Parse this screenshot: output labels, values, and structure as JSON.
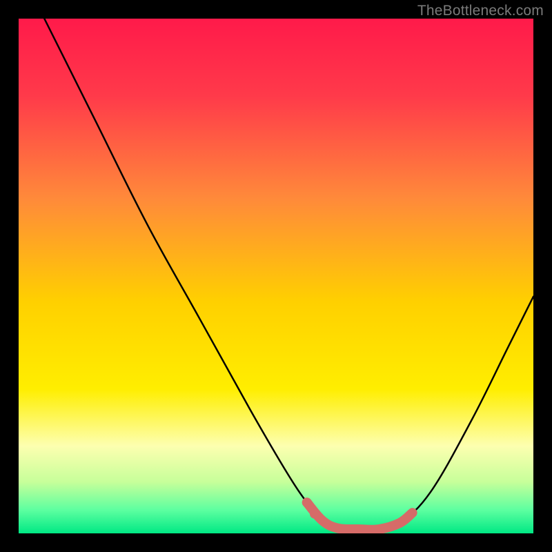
{
  "watermark": "TheBottleneck.com",
  "colors": {
    "curve": "#000000",
    "highlight": "#d66b68",
    "frame": "#000000"
  },
  "chart_data": {
    "type": "line",
    "title": "",
    "xlabel": "",
    "ylabel": "",
    "xlim": [
      0,
      100
    ],
    "ylim": [
      0,
      100
    ],
    "grid": false,
    "legend": false,
    "gradient_stops": [
      {
        "pos": 0.0,
        "color": "#ff1a4a"
      },
      {
        "pos": 0.15,
        "color": "#ff3a4a"
      },
      {
        "pos": 0.35,
        "color": "#ff8a3a"
      },
      {
        "pos": 0.55,
        "color": "#ffd000"
      },
      {
        "pos": 0.72,
        "color": "#ffee00"
      },
      {
        "pos": 0.83,
        "color": "#fdffb0"
      },
      {
        "pos": 0.9,
        "color": "#c7ff9a"
      },
      {
        "pos": 0.955,
        "color": "#5cffa0"
      },
      {
        "pos": 1.0,
        "color": "#00e884"
      }
    ],
    "series": [
      {
        "name": "bottleneck-curve",
        "color": "#000000",
        "points": [
          {
            "x": 5.0,
            "y": 100.0
          },
          {
            "x": 10.0,
            "y": 90.0
          },
          {
            "x": 15.0,
            "y": 80.0
          },
          {
            "x": 25.0,
            "y": 60.0
          },
          {
            "x": 35.0,
            "y": 42.0
          },
          {
            "x": 45.0,
            "y": 24.0
          },
          {
            "x": 52.0,
            "y": 12.0
          },
          {
            "x": 56.0,
            "y": 6.0
          },
          {
            "x": 59.0,
            "y": 2.5
          },
          {
            "x": 62.0,
            "y": 1.0
          },
          {
            "x": 66.0,
            "y": 0.8
          },
          {
            "x": 70.0,
            "y": 0.8
          },
          {
            "x": 74.0,
            "y": 2.0
          },
          {
            "x": 80.0,
            "y": 8.0
          },
          {
            "x": 88.0,
            "y": 22.0
          },
          {
            "x": 95.0,
            "y": 36.0
          },
          {
            "x": 100.0,
            "y": 46.0
          }
        ]
      },
      {
        "name": "optimal-range-highlight",
        "color": "#d66b68",
        "points": [
          {
            "x": 56.0,
            "y": 6.0
          },
          {
            "x": 59.0,
            "y": 2.5
          },
          {
            "x": 62.0,
            "y": 1.0
          },
          {
            "x": 66.0,
            "y": 0.8
          },
          {
            "x": 70.0,
            "y": 0.8
          },
          {
            "x": 74.0,
            "y": 2.0
          },
          {
            "x": 76.5,
            "y": 4.0
          }
        ]
      }
    ],
    "highlight_dots": [
      {
        "x": 56.0,
        "y": 6.0
      },
      {
        "x": 57.5,
        "y": 3.8
      }
    ]
  }
}
